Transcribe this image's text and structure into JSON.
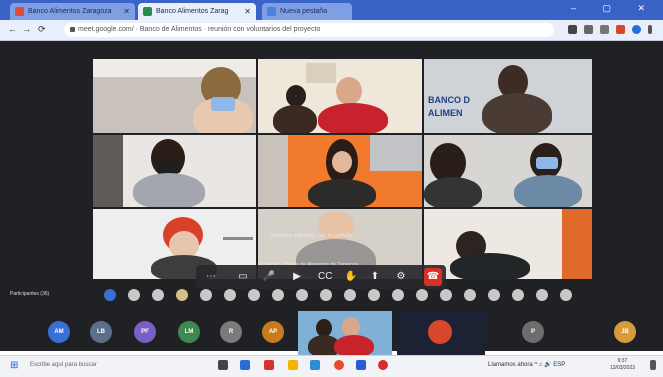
{
  "browser": {
    "tabs": [
      {
        "label": "Banco Alimentos Zaragoza"
      },
      {
        "label": "Banco Alimentos Zarag",
        "active": true
      },
      {
        "label": "Nueva pestaña"
      }
    ],
    "new_tab_label": "+",
    "window_controls": "– ▢ ✕",
    "nav": {
      "back": "←",
      "forward": "→",
      "reload": "⟳"
    },
    "url": "meet.google.com/ · Banco de Alimentos · reunión con voluntarios del proyecto"
  },
  "meet": {
    "tile_label_name": "BANCO DE ALIMENTOS",
    "tile_label_line1": "BANCO D",
    "tile_label_line2": "ALIMEN",
    "caption_top": "Subtítulos activados · ver en pantalla",
    "caption_bottom": "Proyecto ... Banco de Alimentos de Zaragoza",
    "participants_label": "Participantes (36)",
    "toolbar": {
      "mic": "🎤",
      "camera": "▶",
      "captions": "CC",
      "present": "⬆",
      "more": "⋯",
      "raise_hand": "✋",
      "end_call": "☎"
    },
    "avatars": [
      {
        "initials": "AM",
        "color": "#3b6fd6"
      },
      {
        "initials": "LB",
        "color": "#5c6f8a"
      },
      {
        "initials": "PF",
        "color": "#7a5fc6"
      },
      {
        "initials": "LM",
        "color": "#3d8a4e"
      },
      {
        "initials": "R",
        "color": "#7b7b7b"
      },
      {
        "initials": "AP",
        "color": "#c77a1e"
      },
      {
        "initials": "P",
        "color": "#6d6d6d"
      },
      {
        "initials": "JB",
        "color": "#d89b3a"
      }
    ]
  },
  "taskbar": {
    "start_icon": "⊞",
    "search_placeholder": "Escribe aquí para buscar",
    "tray_text": "Llamamos ahora  ^ ⌂ 🔊 ESP",
    "clock_time": "9:37",
    "clock_date": "13/03/2023"
  }
}
